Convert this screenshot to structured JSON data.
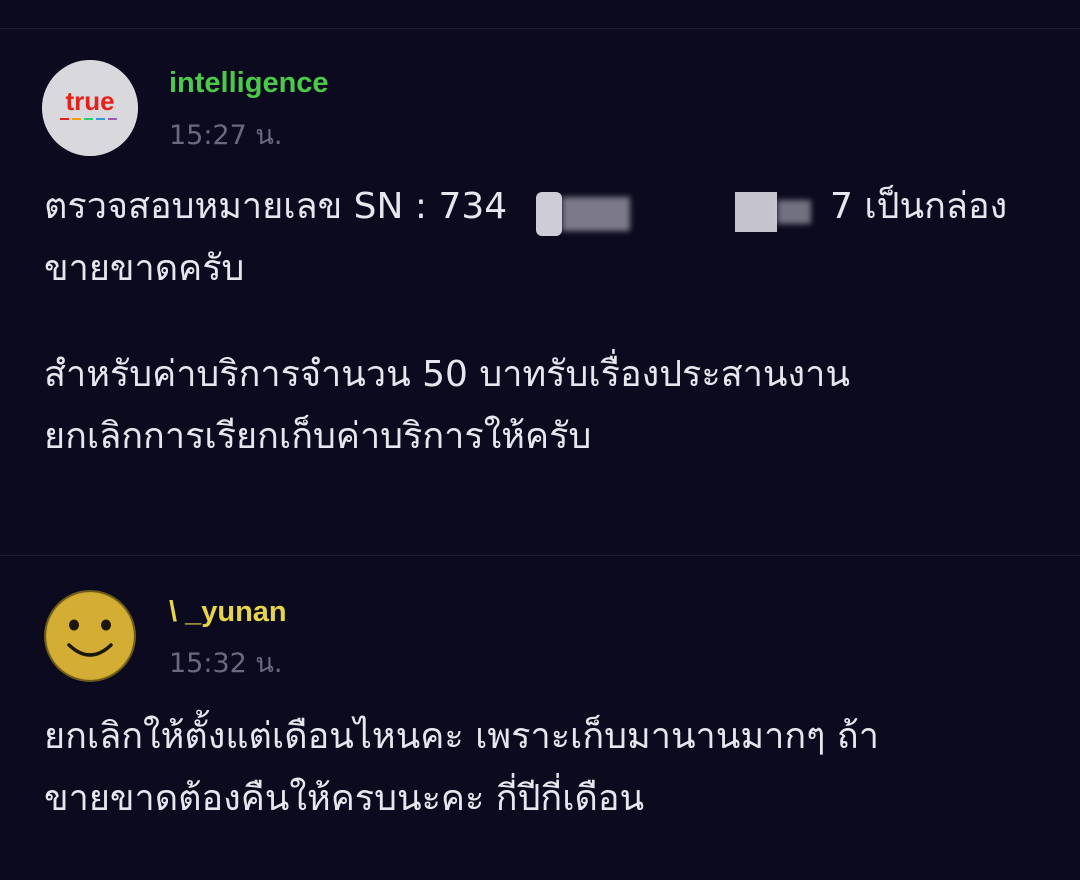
{
  "comments": [
    {
      "username": "intelligence",
      "username_color": "#4cc94a",
      "time": "15:27 น.",
      "avatar": {
        "icon": "true-logo-icon",
        "logo_text": "true"
      },
      "lines": [
        "ตรวจสอบหมายเลข SN : 734",
        "7  เป็นกล่อง",
        "ขายขาดครับ",
        "สำหรับค่าบริการจำนวน 50 บาทรับเรื่องประสานงาน",
        "ยกเลิกการเรียกเก็บค่าบริการให้ครับ"
      ]
    },
    {
      "username": "\\ _yunan",
      "username_color": "#e6d44a",
      "time": "15:32 น.",
      "avatar": {
        "icon": "smiley-face-icon"
      },
      "lines": [
        "ยกเลิกให้ตั้งแต่เดือนไหนคะ เพราะเก็บมานานมากๆ ถ้า",
        "ขายขาดต้องคืนให้ครบนะคะ กี่ปีกี่เดือน"
      ]
    }
  ]
}
